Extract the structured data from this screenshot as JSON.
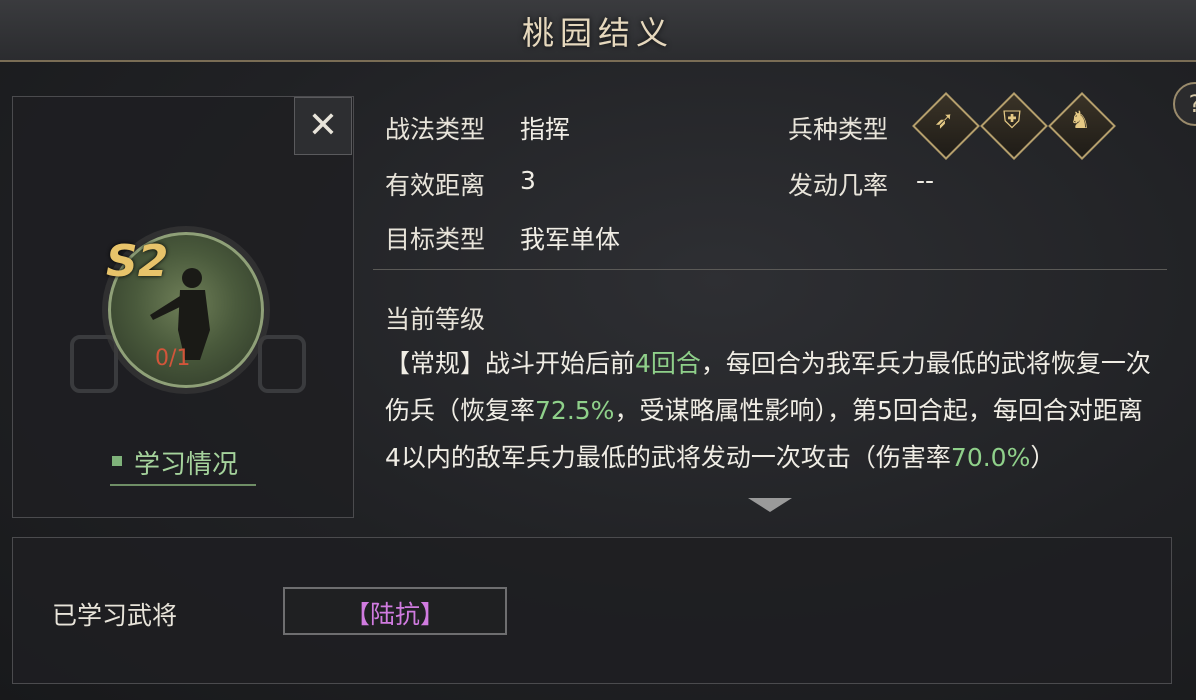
{
  "header": {
    "title": "桃园结义"
  },
  "help": {
    "icon": "?"
  },
  "card": {
    "close_icon": "✕",
    "skill_grade": "S2",
    "skill_progress": "0/1",
    "learn_label": "学习情况"
  },
  "info": {
    "tactic_type_label": "战法类型",
    "tactic_type_value": "指挥",
    "range_label": "有效距离",
    "range_value": "3",
    "target_label": "目标类型",
    "target_value": "我军单体",
    "troop_label": "兵种类型",
    "troop_icons": [
      "bow-cavalry-icon",
      "shield-infantry-icon",
      "horse-cavalry-icon"
    ],
    "rate_label": "发动几率",
    "rate_value": "--"
  },
  "level": {
    "label": "当前等级",
    "desc_parts": [
      "【常规】战斗开始后前",
      "4回合",
      "，每回合为我军兵力最低的武将恢复一次伤兵（恢复率",
      "72.5%",
      "，受谋略属性影响），第5回合起，每回合对距离4以内的敌军兵力最低的武将发动一次攻击（伤害率",
      "70.0%",
      "）"
    ]
  },
  "learned": {
    "label": "已学习武将",
    "general": "【陆抗】"
  },
  "colors": {
    "highlight": "#8fd08a",
    "accent": "#b59f6c",
    "general": "#d07be0"
  }
}
